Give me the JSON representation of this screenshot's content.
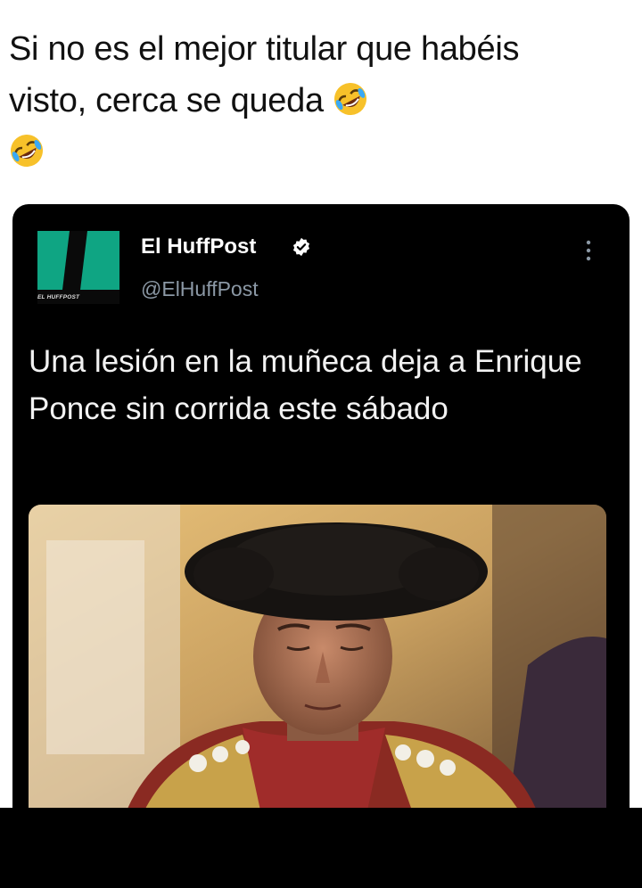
{
  "post": {
    "caption": "Si no es el mejor titular que habéis visto, cerca se queda",
    "emojis": [
      "rolling-on-floor-laughing-emoji",
      "rolling-on-floor-laughing-emoji"
    ]
  },
  "tweet": {
    "author_name": "El HuffPost",
    "author_handle": "@ElHuffPost",
    "verified": true,
    "avatar_logo_text": "EL HUFFPOST",
    "text": "Una lesión en la muñeca deja a Enrique Ponce sin corrida este sábado",
    "media": "bullfighter-photo",
    "menu_icon": "more-options-icon"
  },
  "colors": {
    "card_bg": "#000000",
    "huffpost_green": "#0fa583",
    "verified_badge": "#ffffff",
    "handle_gray": "#8b98a5"
  }
}
